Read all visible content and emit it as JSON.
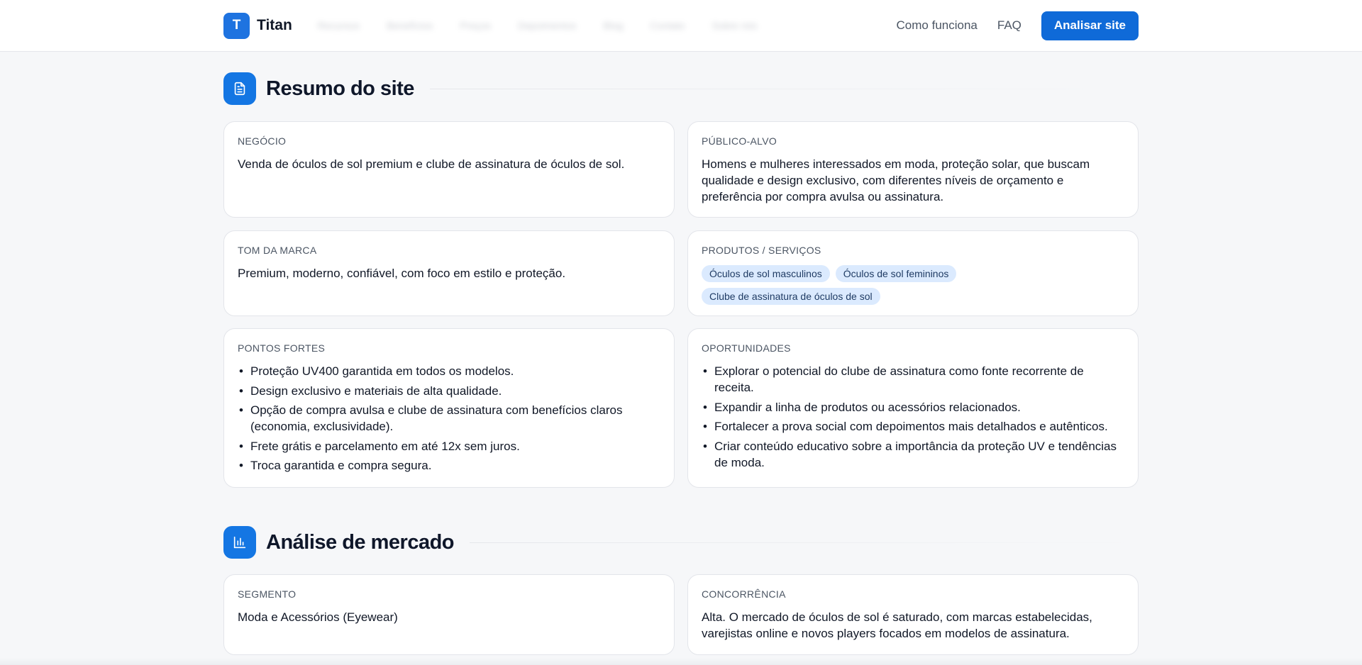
{
  "header": {
    "logo_letter": "T",
    "brand": "Titan",
    "blurred_nav": [
      "Recursos",
      "Benefícios",
      "Preços",
      "Depoimentos",
      "Blog",
      "Contato",
      "Sobre nós"
    ],
    "links": [
      "Como funciona",
      "FAQ"
    ],
    "cta": "Analisar site"
  },
  "resumo": {
    "title": "Resumo do site",
    "negocio": {
      "label": "NEGÓCIO",
      "text": "Venda de óculos de sol premium e clube de assinatura de óculos de sol."
    },
    "publico": {
      "label": "PÚBLICO-ALVO",
      "text": "Homens e mulheres interessados em moda, proteção solar, que buscam qualidade e design exclusivo, com diferentes níveis de orçamento e preferência por compra avulsa ou assinatura."
    },
    "tom": {
      "label": "TOM DA MARCA",
      "text": "Premium, moderno, confiável, com foco em estilo e proteção."
    },
    "produtos": {
      "label": "PRODUTOS / SERVIÇOS",
      "tags": [
        "Óculos de sol masculinos",
        "Óculos de sol femininos",
        "Clube de assinatura de óculos de sol"
      ]
    },
    "pontos": {
      "label": "PONTOS FORTES",
      "items": [
        "Proteção UV400 garantida em todos os modelos.",
        "Design exclusivo e materiais de alta qualidade.",
        "Opção de compra avulsa e clube de assinatura com benefícios claros (economia, exclusividade).",
        "Frete grátis e parcelamento em até 12x sem juros.",
        "Troca garantida e compra segura."
      ]
    },
    "oportunidades": {
      "label": "OPORTUNIDADES",
      "items": [
        "Explorar o potencial do clube de assinatura como fonte recorrente de receita.",
        "Expandir a linha de produtos ou acessórios relacionados.",
        "Fortalecer a prova social com depoimentos mais detalhados e autênticos.",
        "Criar conteúdo educativo sobre a importância da proteção UV e tendências de moda."
      ]
    }
  },
  "mercado": {
    "title": "Análise de mercado",
    "segmento": {
      "label": "SEGMENTO",
      "text": "Moda e Acessórios (Eyewear)"
    },
    "concorrencia": {
      "label": "CONCORRÊNCIA",
      "text": "Alta. O mercado de óculos de sol é saturado, com marcas estabelecidas, varejistas online e novos players focados em modelos de assinatura."
    }
  },
  "colors": {
    "accent": "#0f6ad8",
    "icon_bg": "#1476e3",
    "tag_bg": "#dbeafe"
  }
}
